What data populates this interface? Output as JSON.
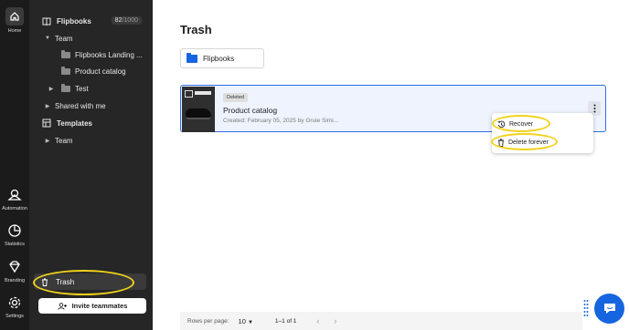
{
  "rail": {
    "home_label": "Home",
    "automation_label": "Automation",
    "statistics_label": "Statistics",
    "branding_label": "Branding",
    "settings_label": "Settings"
  },
  "sidebar": {
    "section_title": "Flipbooks",
    "counter_value": "82",
    "counter_max": "/1000",
    "team_label": "Team",
    "folders": [
      "Flipbooks Landing ...",
      "Product catalog",
      "Test"
    ],
    "shared_label": "Shared with me",
    "templates_label": "Templates",
    "templates_team_label": "Team",
    "trash_label": "Trash",
    "invite_label": "Invite teammates"
  },
  "main": {
    "title": "Trash",
    "folder_chip": "Flipbooks",
    "card": {
      "badge": "Deleted",
      "title": "Product catalog",
      "subtitle": "Created: February 05, 2025 by Gruie Simi..."
    },
    "menu": {
      "recover": "Recover",
      "delete_forever": "Delete forever"
    },
    "footer": {
      "rows_label": "Rows per page:",
      "rows_value": "10",
      "range": "1–1 of 1"
    }
  },
  "colors": {
    "accent": "#1565e0",
    "highlight": "#f2d21b",
    "sidebar_bg": "#262626",
    "rail_bg": "#1b1b1b"
  }
}
